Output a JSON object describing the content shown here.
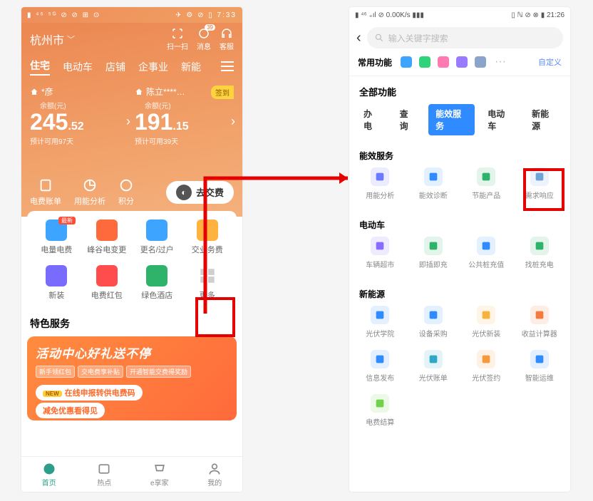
{
  "left": {
    "status": {
      "left": "▮ ⁴⁶ ⁵ᴳ ⊘ ⊘ ⊞ ⊙",
      "right": "✈ ⚙ ⊘ ▯ 7:33"
    },
    "city": "杭州市",
    "top_icons": {
      "scan": "扫一扫",
      "msg": "消息",
      "service": "客服",
      "msg_badge": "39"
    },
    "tabs": [
      "住宅",
      "电动车",
      "店铺",
      "企事业",
      "新能"
    ],
    "accounts": [
      {
        "name": "*彦",
        "bal_label": "余额(元)",
        "int": "245",
        "dec": ".52",
        "est": "预计可用97天"
      },
      {
        "name": "陈立****…",
        "bal_label": "余额(元)",
        "int": "191",
        "dec": ".15",
        "est": "预计可用39天",
        "signin": "签到"
      }
    ],
    "quick": {
      "bill": "电费账单",
      "usage": "用能分析",
      "points": "积分",
      "pay": "去交费"
    },
    "grid": [
      {
        "label": "电量电费",
        "color": "#3da5ff",
        "badge": "最新"
      },
      {
        "label": "峰谷电变更",
        "color": "#ff6a3c"
      },
      {
        "label": "更名/过户",
        "color": "#3da5ff"
      },
      {
        "label": "交业务费",
        "color": "#ffb23d"
      },
      {
        "label": "新装",
        "color": "#7a6bff"
      },
      {
        "label": "电费红包",
        "color": "#ff4d4d"
      },
      {
        "label": "绿色酒店",
        "color": "#2fb36b"
      },
      {
        "label": "更多",
        "color": "#cfcfcf"
      }
    ],
    "special_title": "特色服务",
    "promo": {
      "headline": "活动中心好礼送不停",
      "chips": [
        "新手领红包",
        "交电费享补贴",
        "开通智能交费得奖励"
      ],
      "bubble_new": "NEW",
      "bubble_l1": "在线申报转供电费码",
      "bubble_l2": "减免优惠看得见"
    },
    "bottom": [
      "首页",
      "热点",
      "e享家",
      "我的"
    ]
  },
  "right": {
    "status": {
      "left": "▮ ⁴⁶ ₊ıl ⊘ 0.00K/s ▮▮▮",
      "right": "▯ ℕ ⊘ ⊗ ▮ 21:26"
    },
    "search_placeholder": "输入关键字搜索",
    "fav_label": "常用功能",
    "custom": "自定义",
    "all_label": "全部功能",
    "cats": [
      "办电",
      "查询",
      "能效服务",
      "电动车",
      "新能源"
    ],
    "sections": [
      {
        "title": "能效服务",
        "items": [
          {
            "label": "用能分析",
            "color": "#6b7bff"
          },
          {
            "label": "能效诊断",
            "color": "#2f8bff"
          },
          {
            "label": "节能产品",
            "color": "#2fb36b"
          },
          {
            "label": "需求响应",
            "color": "#6fa4d6"
          }
        ]
      },
      {
        "title": "电动车",
        "items": [
          {
            "label": "车辆超市",
            "color": "#8a6bff"
          },
          {
            "label": "即插即充",
            "color": "#2fb36b"
          },
          {
            "label": "公共桩充值",
            "color": "#2f8bff"
          },
          {
            "label": "找桩充电",
            "color": "#2fb36b"
          }
        ]
      },
      {
        "title": "新能源",
        "items": [
          {
            "label": "光伏学院",
            "color": "#2f8bff"
          },
          {
            "label": "设备采购",
            "color": "#2f8bff"
          },
          {
            "label": "光伏新装",
            "color": "#f7b23d"
          },
          {
            "label": "收益计算器",
            "color": "#f47b3d"
          },
          {
            "label": "信息发布",
            "color": "#2f8bff"
          },
          {
            "label": "光伏账单",
            "color": "#2fa8c9"
          },
          {
            "label": "光伏签约",
            "color": "#f79a3d"
          },
          {
            "label": "智能运维",
            "color": "#2f8bff"
          },
          {
            "label": "电费结算",
            "color": "#6fd24a"
          }
        ]
      }
    ]
  }
}
